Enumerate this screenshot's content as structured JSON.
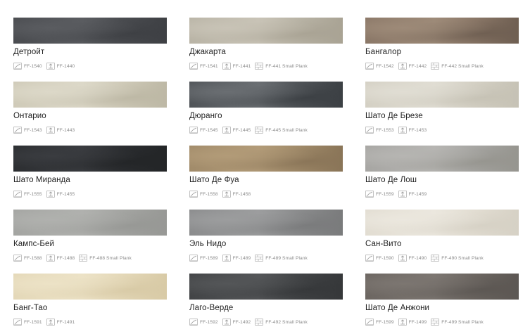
{
  "icons": {
    "plank": "plank-icon",
    "tile": "tile-icon",
    "small_plank": "small-plank-icon"
  },
  "swatches": [
    {
      "name": "Детройт",
      "colors": [
        "#4a4c50",
        "#5a5c60",
        "#3e4044"
      ],
      "codes": [
        {
          "type": "plank",
          "label": "FF-1540"
        },
        {
          "type": "tile",
          "label": "FF-1440"
        }
      ]
    },
    {
      "name": "Джакарта",
      "colors": [
        "#b9b4a6",
        "#c8c3b6",
        "#a9a394"
      ],
      "codes": [
        {
          "type": "plank",
          "label": "FF-1541"
        },
        {
          "type": "tile",
          "label": "FF-1441"
        },
        {
          "type": "small_plank",
          "label": "FF-441 Small Plank"
        }
      ]
    },
    {
      "name": "Бангалор",
      "colors": [
        "#8b7868",
        "#9d8a78",
        "#6f5f52"
      ],
      "codes": [
        {
          "type": "plank",
          "label": "FF-1542"
        },
        {
          "type": "tile",
          "label": "FF-1442"
        },
        {
          "type": "small_plank",
          "label": "FF-442 Small Plank"
        }
      ]
    },
    {
      "name": "Онтарио",
      "colors": [
        "#cfcab8",
        "#dcd8c8",
        "#bdb8a5"
      ],
      "codes": [
        {
          "type": "plank",
          "label": "FF-1543"
        },
        {
          "type": "tile",
          "label": "FF-1443"
        }
      ]
    },
    {
      "name": "Дюранго",
      "colors": [
        "#505458",
        "#6a6e72",
        "#3c4044"
      ],
      "codes": [
        {
          "type": "plank",
          "label": "FF-1545"
        },
        {
          "type": "tile",
          "label": "FF-1445"
        },
        {
          "type": "small_plank",
          "label": "FF-445 Small Plank"
        }
      ]
    },
    {
      "name": "Шато Де Брезе",
      "colors": [
        "#d4d0c4",
        "#e0ddd3",
        "#c6c2b5"
      ],
      "codes": [
        {
          "type": "plank",
          "label": "FF-1553"
        },
        {
          "type": "tile",
          "label": "FF-1453"
        }
      ]
    },
    {
      "name": "Шато Миранда",
      "colors": [
        "#2c2e31",
        "#3a3c40",
        "#232527"
      ],
      "codes": [
        {
          "type": "plank",
          "label": "FF-1555"
        },
        {
          "type": "tile",
          "label": "FF-1455"
        }
      ]
    },
    {
      "name": "Шато Де Фуа",
      "colors": [
        "#a18b6a",
        "#b29b78",
        "#8a7558"
      ],
      "codes": [
        {
          "type": "plank",
          "label": "FF-1558"
        },
        {
          "type": "tile",
          "label": "FF-1458"
        }
      ]
    },
    {
      "name": "Шато Де Лош",
      "colors": [
        "#a7a6a3",
        "#b6b5b2",
        "#96958f"
      ],
      "codes": [
        {
          "type": "plank",
          "label": "FF-1559"
        },
        {
          "type": "tile",
          "label": "FF-1459"
        }
      ]
    },
    {
      "name": "Кампс-Бей",
      "colors": [
        "#a4a5a2",
        "#b0b1ae",
        "#979895"
      ],
      "codes": [
        {
          "type": "plank",
          "label": "FF-1588"
        },
        {
          "type": "tile",
          "label": "FF-1488"
        },
        {
          "type": "small_plank",
          "label": "FF-488 Small Plank"
        }
      ]
    },
    {
      "name": "Эль Нидо",
      "colors": [
        "#8b8c8d",
        "#9c9d9e",
        "#7a7b7c"
      ],
      "codes": [
        {
          "type": "plank",
          "label": "FF-1589"
        },
        {
          "type": "tile",
          "label": "FF-1489"
        },
        {
          "type": "small_plank",
          "label": "FF-489 Small Plank"
        }
      ]
    },
    {
      "name": "Сан-Вито",
      "colors": [
        "#e2ddd2",
        "#ebe7de",
        "#d6d1c5"
      ],
      "codes": [
        {
          "type": "plank",
          "label": "FF-1590"
        },
        {
          "type": "tile",
          "label": "FF-1490"
        },
        {
          "type": "small_plank",
          "label": "FF-490 Small Plank"
        }
      ]
    },
    {
      "name": "Банг-Тао",
      "colors": [
        "#e4d8b8",
        "#ece2c6",
        "#d8caa6"
      ],
      "codes": [
        {
          "type": "plank",
          "label": "FF-1591"
        },
        {
          "type": "tile",
          "label": "FF-1491"
        }
      ]
    },
    {
      "name": "Лаго-Верде",
      "colors": [
        "#424446",
        "#545658",
        "#36383a"
      ],
      "codes": [
        {
          "type": "plank",
          "label": "FF-1592"
        },
        {
          "type": "tile",
          "label": "FF-1492"
        },
        {
          "type": "small_plank",
          "label": "FF-492 Small Plank"
        }
      ]
    },
    {
      "name": "Шато Де Анжони",
      "colors": [
        "#6c6661",
        "#7c7671",
        "#5c5753"
      ],
      "codes": [
        {
          "type": "plank",
          "label": "FF-1599"
        },
        {
          "type": "tile",
          "label": "FF-1499"
        },
        {
          "type": "small_plank",
          "label": "FF-499 Small Plank"
        }
      ]
    }
  ]
}
